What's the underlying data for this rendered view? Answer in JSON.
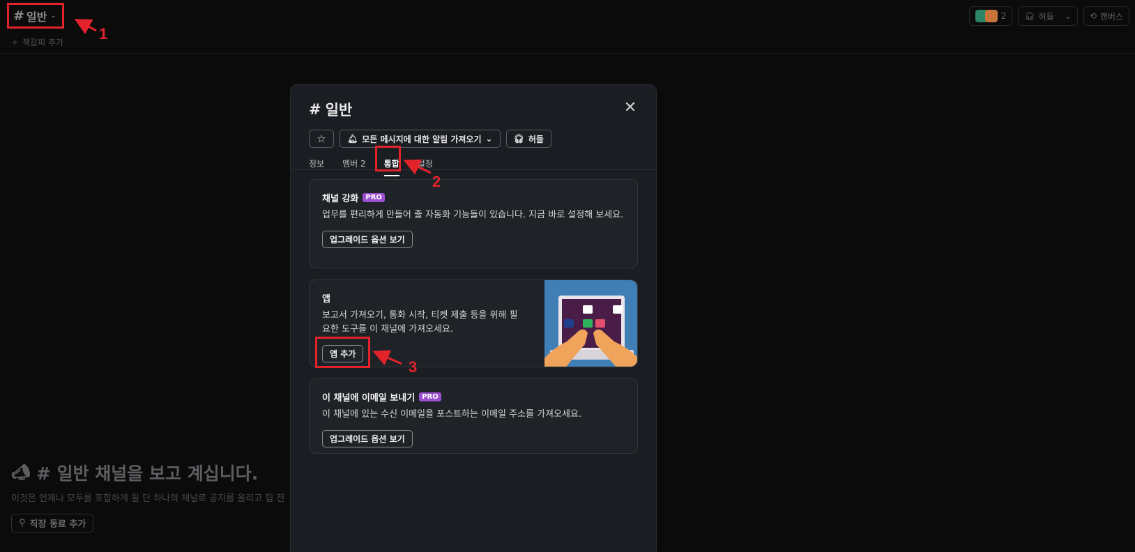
{
  "topbar": {
    "channel_hash": "#",
    "channel_name": "일반",
    "bookmark_add": "책갈피 추가",
    "member_count": "2",
    "huddle_label": "허들",
    "canvas_label": "캔버스"
  },
  "intro": {
    "title": "# 일반 채널을 보고 계십니다.",
    "description": "이것은 언제나 모두를 포함하게 될 단 하나의 채널로 공지를 올리고 팀 전",
    "add_coworker": "직장 동료 추가"
  },
  "modal": {
    "title_hash": "#",
    "title_name": "일반",
    "notify_label": "모든 메시지에 대한 알림 가져오기",
    "huddle_label": "허들",
    "tabs": [
      {
        "label": "정보"
      },
      {
        "label": "멤버 2"
      },
      {
        "label": "통합"
      },
      {
        "label": "설정"
      }
    ],
    "cards": {
      "boost": {
        "title": "채널 강화",
        "badge": "PRO",
        "description": "업무를 편리하게 만들어 줄 자동화 기능들이 있습니다. 지금 바로 설정해 보세요.",
        "button": "업그레이드 옵션 보기"
      },
      "apps": {
        "title": "앱",
        "description": "보고서 가져오기, 통화 시작, 티켓 제출 등을 위해 필요한 도구를 이 채널에 가져오세요.",
        "button": "앱 추가"
      },
      "email": {
        "title": "이 채널에 이메일 보내기",
        "badge": "PRO",
        "description": "이 채널에 있는 수신 이메일을 포스트하는 이메일 주소를 가져오세요.",
        "button": "업그레이드 옵션 보기"
      }
    }
  },
  "annotations": [
    "1",
    "2",
    "3"
  ],
  "colors": {
    "annotation_red": "#e3232c",
    "modal_bg": "#1a1d21",
    "pro_badge": "#9b4fd1"
  }
}
